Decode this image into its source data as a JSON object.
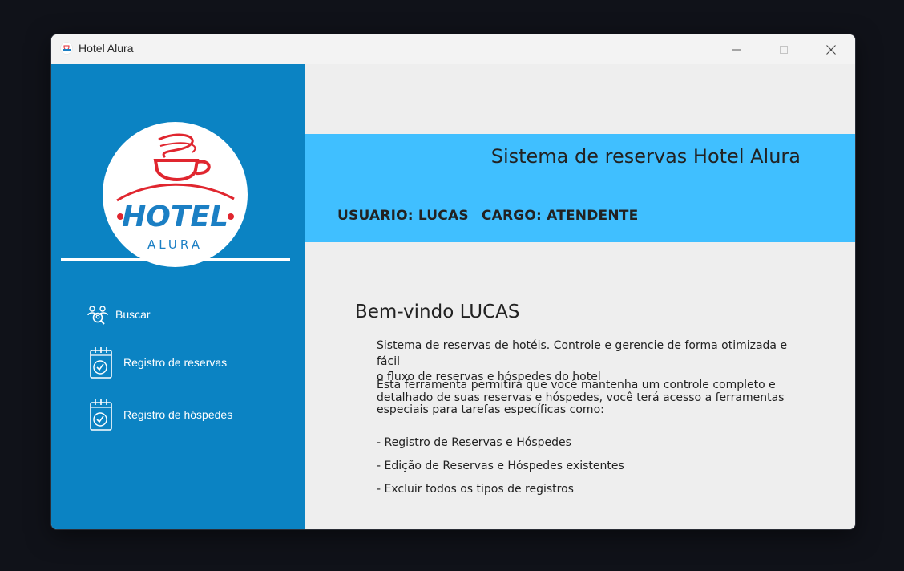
{
  "window": {
    "title": "Hotel Alura",
    "controls": {
      "minimize": "minimize-icon",
      "maximize": "maximize-icon",
      "close": "close-icon"
    }
  },
  "sidebar": {
    "logo": {
      "line1": "HOTEL",
      "line2": "ALURA"
    },
    "items": [
      {
        "label": "Buscar",
        "icon": "people-search-icon"
      },
      {
        "label": "Registro de reservas",
        "icon": "calendar-check-icon"
      },
      {
        "label": "Registro de hóspedes",
        "icon": "calendar-check-icon"
      }
    ]
  },
  "banner": {
    "title": "Sistema de reservas Hotel Alura",
    "user": "USUARIO: LUCAS",
    "role": "CARGO: ATENDENTE"
  },
  "main": {
    "welcome": "Bem-vindo LUCAS",
    "paragraph1_line1": "Sistema de reservas de hotéis. Controle e gerencie de forma otimizada e fácil",
    "paragraph1_line2": "o fluxo de reservas e hóspedes do hotel",
    "paragraph2_line1": "Esta ferramenta permitirá que você mantenha um controle completo e",
    "paragraph2_line2": "detalhado de suas reservas e hóspedes, você terá acesso a ferramentas",
    "paragraph2_line3": "especiais para tarefas específicas como:",
    "list": [
      "- Registro de Reservas e Hóspedes",
      "- Edição de Reservas e Hóspedes existentes",
      "- Excluir todos os tipos de registros"
    ]
  },
  "colors": {
    "sidebar": "#0b83c3",
    "banner": "#40bfff",
    "background": "#eeeeee",
    "logo_red": "#e0262f",
    "logo_blue": "#1b7fc4"
  }
}
